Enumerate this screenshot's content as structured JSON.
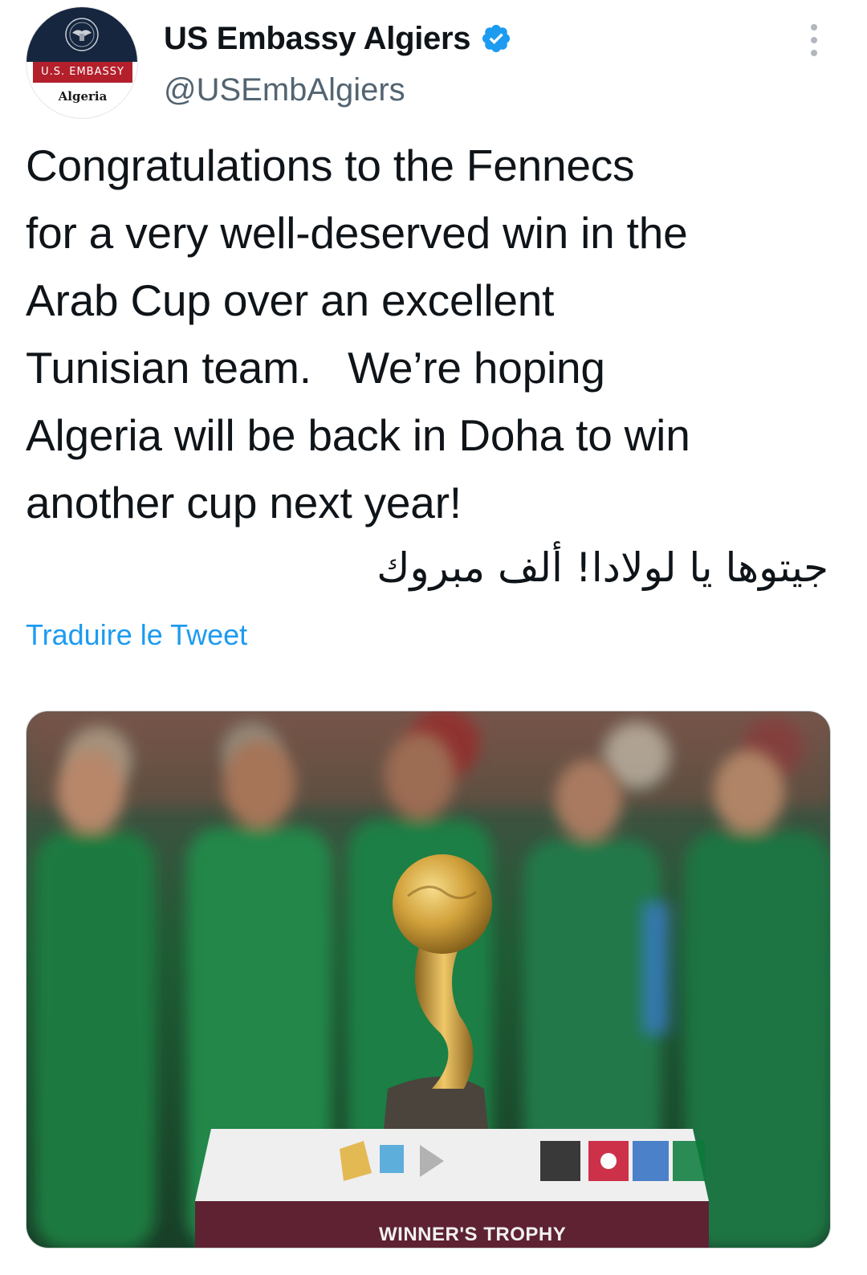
{
  "header": {
    "display_name": "US Embassy Algiers",
    "handle": "@USEmbAlgiers",
    "verified_icon": "verified-badge-icon",
    "more_icon": "more-vertical-icon"
  },
  "avatar": {
    "band_text": "U.S. EMBASSY",
    "sub_text": "Algeria",
    "colors": {
      "navy": "#16263f",
      "red": "#b3202c"
    }
  },
  "tweet": {
    "text": "Congratulations to the Fennecs\nfor a very well-deserved win in the\nArab Cup over an excellent\nTunisian team.   We’re hoping\nAlgeria will be back in Doha to win\nanother cup next year!",
    "arabic_text": "جيتوها يا لولادا! ألف مبروك",
    "translate_label": "Traduire le Tweet"
  },
  "media": {
    "description_icon": "photo",
    "caption": "WINNER'S TROPHY"
  },
  "colors": {
    "accent": "#1d9bf0",
    "text": "#0f1419",
    "secondary": "#536471"
  }
}
